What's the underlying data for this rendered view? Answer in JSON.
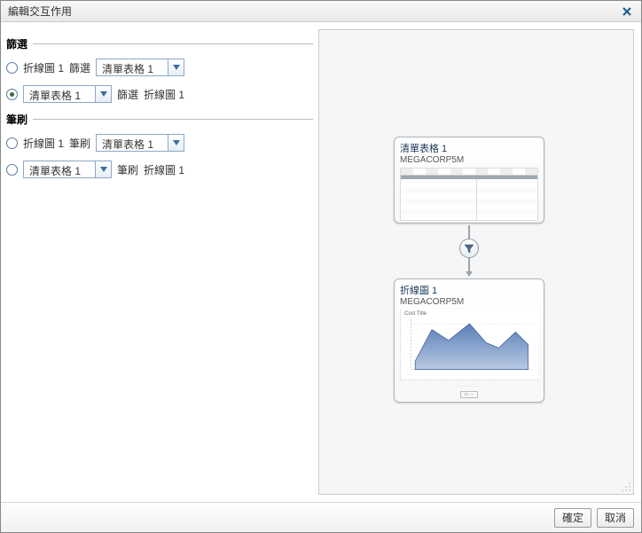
{
  "dialog": {
    "title": "編輯交互作用"
  },
  "sections": {
    "filter": {
      "label": "篩選"
    },
    "brush": {
      "label": "筆刷"
    }
  },
  "rows": {
    "filter1": {
      "source": "折線圖 1",
      "verb": "篩選",
      "combo": "清單表格 1"
    },
    "filter2": {
      "combo": "清單表格 1",
      "verb": "篩選",
      "target": "折線圖 1"
    },
    "brush1": {
      "source": "折線圖 1",
      "verb": "筆刷",
      "combo": "清單表格 1"
    },
    "brush2": {
      "combo": "清單表格 1",
      "verb": "筆刷",
      "target": "折線圖 1"
    }
  },
  "cards": {
    "table": {
      "title": "清單表格 1",
      "sub": "MEGACORP5M"
    },
    "chart": {
      "title": "折線圖 1",
      "sub": "MEGACORP5M",
      "miniTitle": "Cost Title"
    }
  },
  "footer": {
    "ok": "確定",
    "cancel": "取消"
  },
  "chart_data": {
    "type": "area",
    "title": "折線圖 1",
    "dataset": "MEGACORP5M",
    "x": [
      1,
      2,
      3,
      4,
      5,
      6,
      7,
      8
    ],
    "values": [
      20,
      70,
      55,
      85,
      60,
      52,
      75,
      58
    ],
    "ylim": [
      0,
      100
    ],
    "xlabel": "",
    "ylabel": ""
  }
}
